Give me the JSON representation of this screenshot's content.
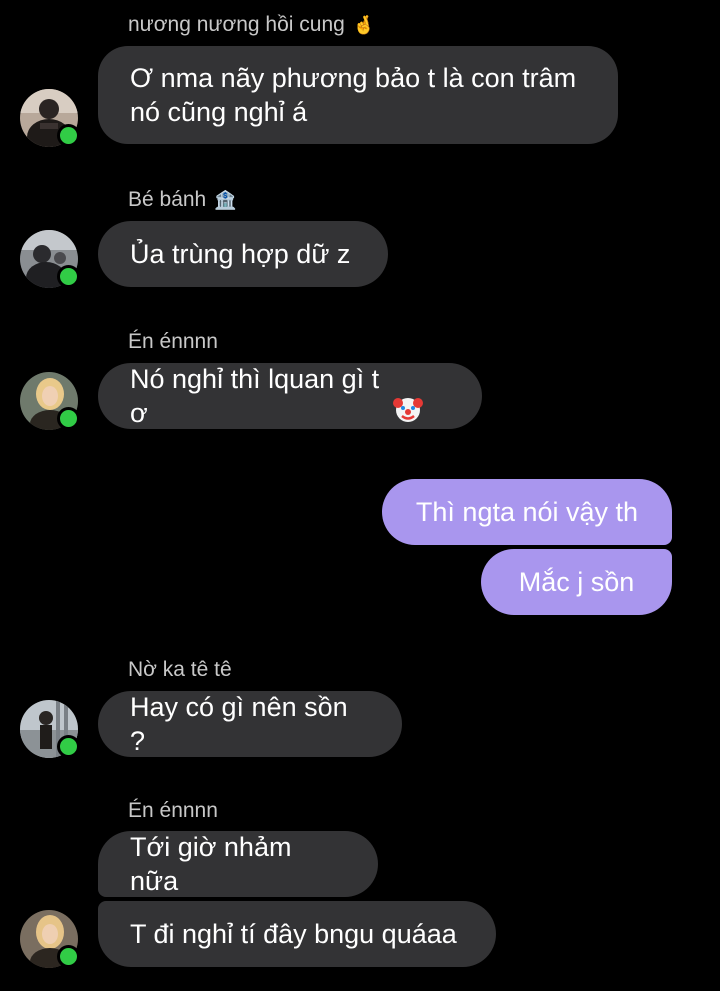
{
  "messages": [
    {
      "sender": "nương nương hồi cung",
      "sender_emoji": "🤞",
      "text": "Ơ nma nãy phương bảo t là con trâm\nnó cũng nghỉ á",
      "avatar": "user-avatar-photo"
    },
    {
      "sender": "Bé bánh",
      "sender_emoji": "🏦",
      "text": "Ủa trùng hợp dữ z",
      "avatar": "user-avatar-photo"
    },
    {
      "sender": "Én énnnn",
      "text": "Nó nghỉ thì lquan gì t ơ",
      "text_emoji": "🤡",
      "avatar": "user-avatar-photo"
    },
    {
      "outgoing": [
        "Thì ngta nói vậy th",
        "Mắc j sồn"
      ]
    },
    {
      "sender": "Nờ ka tê tê",
      "text": "Hay có gì nên sồn ?",
      "avatar": "user-avatar-photo"
    },
    {
      "sender": "Én énnnn",
      "texts": [
        "Tới giờ nhảm nữa",
        "T đi nghỉ tí đây bngu quáaa"
      ],
      "avatar": "user-avatar-photo"
    }
  ],
  "colors": {
    "background": "#000000",
    "incoming_bubble": "#333335",
    "outgoing_bubble": "#a996ee",
    "online_dot": "#31cc46",
    "sender_name": "#c8c8c8"
  }
}
